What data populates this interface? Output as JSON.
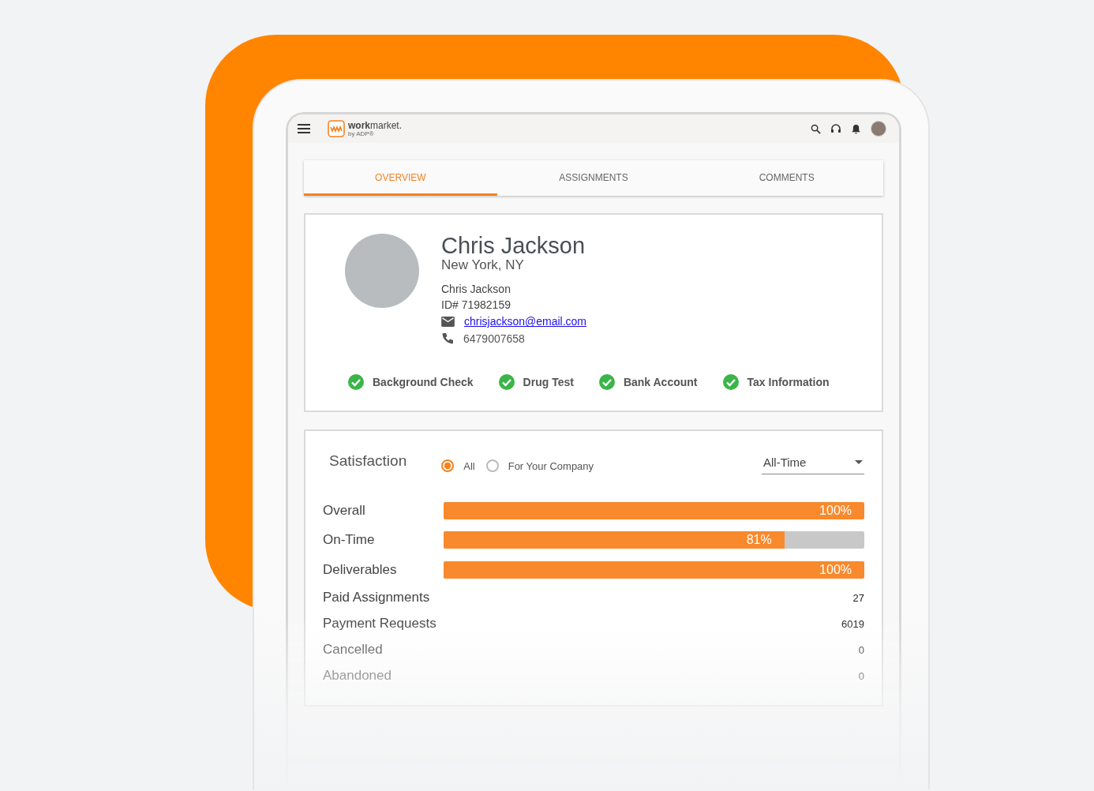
{
  "header": {
    "logo": {
      "wordmark": "**work**market.",
      "tagline": "by ADP®"
    }
  },
  "tabs": [
    {
      "label": "OVERVIEW",
      "selected": true
    },
    {
      "label": "ASSIGNMENTS",
      "selected": false
    },
    {
      "label": "COMMENTS",
      "selected": false
    }
  ],
  "profile": {
    "name": "Chris Jackson",
    "location": "New York, NY",
    "display_name": "Chris Jackson",
    "id": "ID# 71982159",
    "email": "chrisjackson@email.com",
    "phone": "6479007658",
    "checks": [
      {
        "label": "Background Check",
        "passed": true
      },
      {
        "label": "Drug Test",
        "passed": true
      },
      {
        "label": "Bank Account",
        "passed": true
      },
      {
        "label": "Tax Information",
        "passed": true
      }
    ]
  },
  "satisfaction": {
    "title": "Satisfaction",
    "filters": [
      {
        "label": "All",
        "selected": true
      },
      {
        "label": "For Your Company",
        "selected": false
      }
    ],
    "period": {
      "value": "All-Time"
    },
    "rows": [
      {
        "kind": "bar",
        "label": "Overall",
        "level": 1,
        "reading": "100%"
      },
      {
        "kind": "bar",
        "label": "On-Time",
        "level": 0.81,
        "reading": "81%"
      },
      {
        "kind": "bar",
        "label": "Deliverables",
        "level": 1,
        "reading": "100%"
      },
      {
        "kind": "count",
        "label": "Paid Assignments",
        "value": "27"
      },
      {
        "kind": "count",
        "label": "Payment Requests",
        "value": "6019"
      },
      {
        "kind": "count",
        "label": "Cancelled",
        "value": "0"
      },
      {
        "kind": "count",
        "label": "Abandoned",
        "value": "0"
      }
    ]
  }
}
